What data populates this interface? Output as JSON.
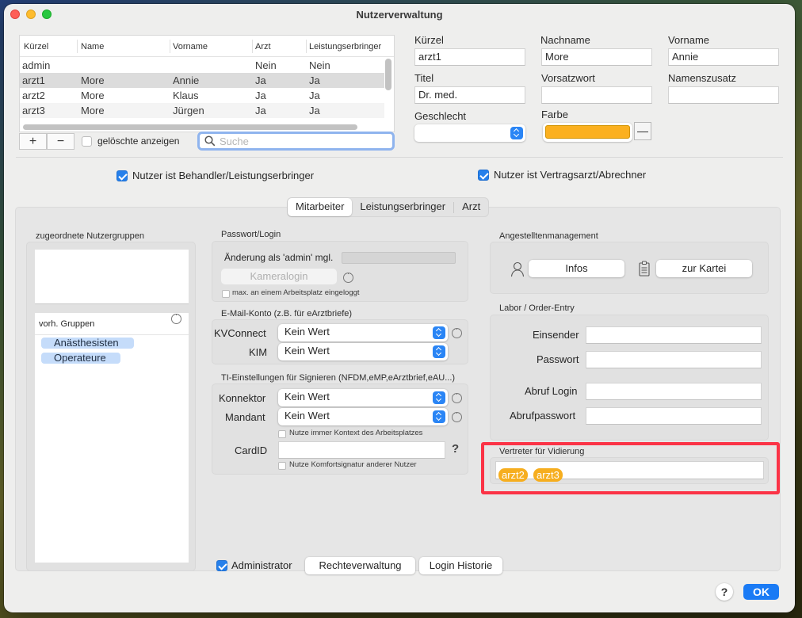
{
  "window": {
    "title": "Nutzerverwaltung"
  },
  "user_table": {
    "columns": [
      "Kürzel",
      "Name",
      "Vorname",
      "Arzt",
      "Leistungserbringer"
    ],
    "rows": [
      {
        "kuerzel": "admin",
        "name": "",
        "vorname": "",
        "arzt": "Nein",
        "leistungserbringer": "Nein"
      },
      {
        "kuerzel": "arzt1",
        "name": "More",
        "vorname": "Annie",
        "arzt": "Ja",
        "leistungserbringer": "Ja"
      },
      {
        "kuerzel": "arzt2",
        "name": "More",
        "vorname": "Klaus",
        "arzt": "Ja",
        "leistungserbringer": "Ja"
      },
      {
        "kuerzel": "arzt3",
        "name": "More",
        "vorname": "Jürgen",
        "arzt": "Ja",
        "leistungserbringer": "Ja"
      }
    ],
    "selected_row": 1,
    "add_label": "+",
    "remove_label": "−",
    "show_deleted_label": "gelöschte anzeigen",
    "search_placeholder": "Suche"
  },
  "detail_form": {
    "kuerzel": {
      "label": "Kürzel",
      "value": "arzt1"
    },
    "nachname": {
      "label": "Nachname",
      "value": "More"
    },
    "vorname": {
      "label": "Vorname",
      "value": "Annie"
    },
    "titel": {
      "label": "Titel",
      "value": "Dr. med."
    },
    "vorsatzwort": {
      "label": "Vorsatzwort",
      "value": ""
    },
    "namenszusatz": {
      "label": "Namenszusatz",
      "value": ""
    },
    "geschlecht": {
      "label": "Geschlecht",
      "value": ""
    },
    "farbe": {
      "label": "Farbe",
      "color": "#fbb01f",
      "remove_label": "—"
    }
  },
  "checkboxes": {
    "behandler": {
      "label": "Nutzer ist Behandler/Leistungserbringer",
      "checked": true
    },
    "vertragsarzt": {
      "label": "Nutzer ist Vertragsarzt/Abrechner",
      "checked": true
    }
  },
  "tabs": [
    {
      "label": "Mitarbeiter",
      "active": true
    },
    {
      "label": "Leistungserbringer",
      "active": false
    },
    {
      "label": "Arzt",
      "active": false
    }
  ],
  "groups": {
    "title": "zugeordnete Nutzergruppen",
    "available_title": "vorh. Gruppen",
    "available": [
      "Anästhesisten",
      "Operateure"
    ]
  },
  "password_login": {
    "title": "Passwort/Login",
    "change_label": "Änderung als 'admin' mgl.",
    "camera_login_label": "Kameralogin",
    "max_one_workstation_label": "max. an einem Arbeitsplatz eingeloggt"
  },
  "email_account": {
    "title": "E-Mail-Konto (z.B. für eArztbriefe)",
    "kvconnect": {
      "label": "KVConnect",
      "value": "Kein Wert"
    },
    "kim": {
      "label": "KIM",
      "value": "Kein Wert"
    }
  },
  "ti_settings": {
    "title": "TI-Einstellungen für Signieren (NFDM,eMP,eArztbrief,eAU...)",
    "konnektor": {
      "label": "Konnektor",
      "value": "Kein Wert"
    },
    "mandant": {
      "label": "Mandant",
      "value": "Kein Wert"
    },
    "always_context_label": "Nutze immer Kontext des Arbeitsplatzes",
    "cardid": {
      "label": "CardID",
      "value": ""
    },
    "help_label": "?",
    "comfort_signature_label": "Nutze Komfortsignatur anderer Nutzer"
  },
  "employee_management": {
    "title": "Angestelltenmanagement",
    "infos_label": "Infos",
    "kartei_label": "zur Kartei"
  },
  "lab_order_entry": {
    "title": "Labor / Order-Entry",
    "einsender": {
      "label": "Einsender",
      "value": ""
    },
    "passwort": {
      "label": "Passwort",
      "value": ""
    },
    "abruf_login": {
      "label": "Abruf Login",
      "value": ""
    },
    "abrufpasswort": {
      "label": "Abrufpasswort",
      "value": ""
    }
  },
  "substitute": {
    "title": "Vertreter für Vidierung",
    "tokens": [
      "arzt2",
      "arzt3"
    ],
    "token_color": "#f6ae1f",
    "highlight_color": "#fb3346"
  },
  "bottom": {
    "administrator_label": "Administrator",
    "administrator_checked": true,
    "rights_label": "Rechteverwaltung",
    "login_history_label": "Login Historie",
    "help_label": "?",
    "ok_label": "OK"
  }
}
